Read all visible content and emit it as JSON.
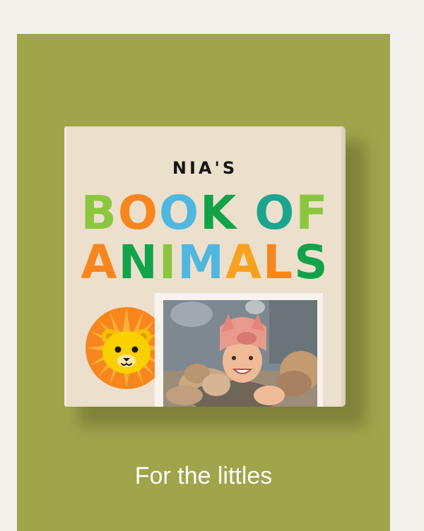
{
  "book": {
    "owner_label": "NIA'S",
    "title_line1": [
      "B",
      "O",
      "O",
      "K",
      " ",
      "O",
      "F"
    ],
    "title_line2": [
      "A",
      "N",
      "I",
      "M",
      "A",
      "L",
      "S"
    ],
    "title_line1_colors": [
      "#8cc63f",
      "#f7861e",
      "#4fb7e0",
      "#12a34a",
      "",
      "#1aa58f",
      "#8cc63f"
    ],
    "title_line2_colors": [
      "#f7861e",
      "#12a34a",
      "#8cc63f",
      "#4fb7e0",
      "#f7a21e",
      "#f7861e",
      "#12a34a"
    ]
  },
  "colors": {
    "card_background": "#a0a44b",
    "page_background": "#f3f1ec",
    "book_cover": "#ece0cc"
  },
  "card": {
    "tagline": "For the littles"
  }
}
